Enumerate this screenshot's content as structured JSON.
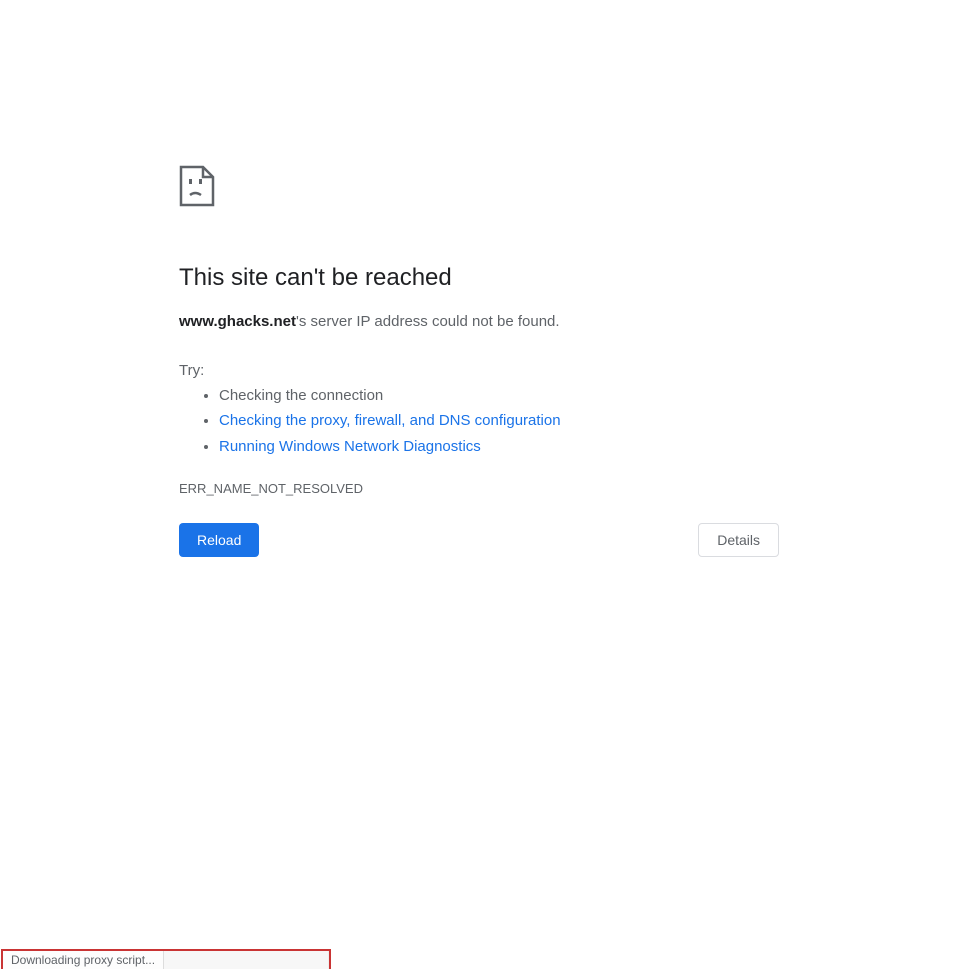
{
  "error": {
    "title": "This site can't be reached",
    "domain": "www.ghacks.net",
    "message_suffix": "'s server IP address could not be found.",
    "try_label": "Try:",
    "suggestions": [
      {
        "text": "Checking the connection",
        "link": false
      },
      {
        "text": "Checking the proxy, firewall, and DNS configuration",
        "link": true
      },
      {
        "text": "Running Windows Network Diagnostics",
        "link": true
      }
    ],
    "code": "ERR_NAME_NOT_RESOLVED"
  },
  "buttons": {
    "reload": "Reload",
    "details": "Details"
  },
  "status_bar": {
    "text": "Downloading proxy script..."
  }
}
